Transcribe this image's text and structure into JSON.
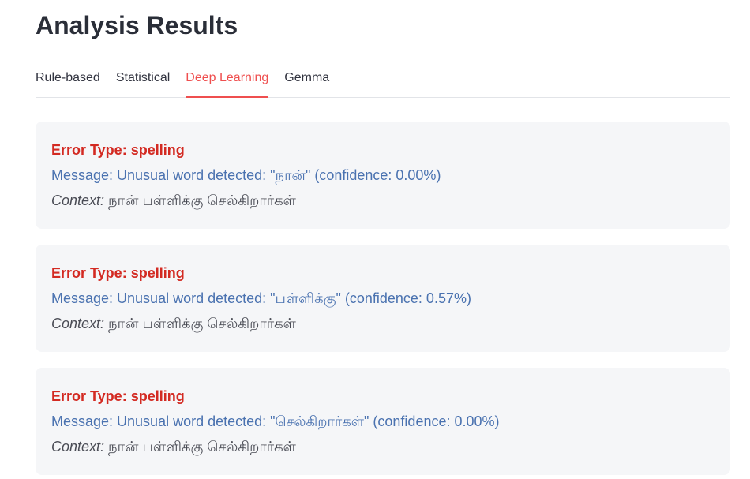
{
  "page_title": "Analysis Results",
  "tabs": [
    {
      "label": "Rule-based",
      "active": false
    },
    {
      "label": "Statistical",
      "active": false
    },
    {
      "label": "Deep Learning",
      "active": true
    },
    {
      "label": "Gemma",
      "active": false
    }
  ],
  "colors": {
    "accent": "#ef4f4f",
    "error_type": "#d32a22",
    "message": "#4a72b0",
    "card_bg": "#f5f6f8"
  },
  "results": [
    {
      "error_type": "Error Type: spelling",
      "message": "Message: Unusual word detected: \"நான்\" (confidence: 0.00%)",
      "context_label": "Context:",
      "context_text": " நான் பள்ளிக்கு செல்கிறார்கள்"
    },
    {
      "error_type": "Error Type: spelling",
      "message": "Message: Unusual word detected: \"பள்ளிக்கு\" (confidence: 0.57%)",
      "context_label": "Context:",
      "context_text": " நான் பள்ளிக்கு செல்கிறார்கள்"
    },
    {
      "error_type": "Error Type: spelling",
      "message": "Message: Unusual word detected: \"செல்கிறார்கள்\" (confidence: 0.00%)",
      "context_label": "Context:",
      "context_text": " நான் பள்ளிக்கு செல்கிறார்கள்"
    }
  ]
}
